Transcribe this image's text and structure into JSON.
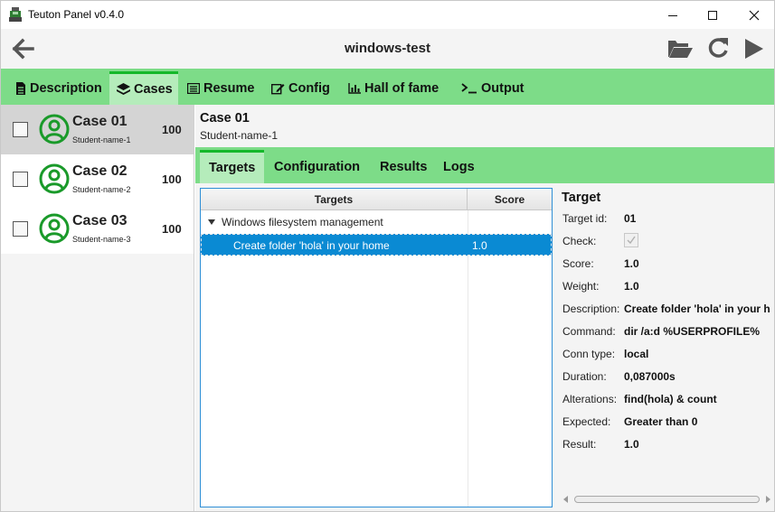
{
  "window": {
    "title": "Teuton Panel v0.4.0"
  },
  "header": {
    "title": "windows-test"
  },
  "main_tabs": [
    {
      "label": "Description",
      "icon": "document-icon"
    },
    {
      "label": "Cases",
      "icon": "layers-icon"
    },
    {
      "label": "Resume",
      "icon": "list-icon"
    },
    {
      "label": "Config",
      "icon": "edit-icon"
    },
    {
      "label": "Hall of fame",
      "icon": "bar-chart-icon"
    },
    {
      "label": "Output",
      "icon": "terminal-icon"
    }
  ],
  "active_main_tab": "Cases",
  "cases": [
    {
      "name": "Case 01",
      "student": "Student-name-1",
      "score": "100"
    },
    {
      "name": "Case 02",
      "student": "Student-name-2",
      "score": "100"
    },
    {
      "name": "Case 03",
      "student": "Student-name-3",
      "score": "100"
    }
  ],
  "selected_case": {
    "title": "Case 01",
    "student": "Student-name-1"
  },
  "sub_tabs": [
    "Targets",
    "Configuration",
    "Results",
    "Logs"
  ],
  "active_sub_tab": "Targets",
  "targets_table": {
    "columns": [
      "Targets",
      "Score"
    ],
    "group": "Windows filesystem management",
    "rows": [
      {
        "target": "Create folder 'hola' in your home",
        "score": "1.0"
      }
    ]
  },
  "details": {
    "title": "Target",
    "rows": [
      {
        "label": "Target id:",
        "value": "01"
      },
      {
        "label": "Check:",
        "value": ""
      },
      {
        "label": "Score:",
        "value": "1.0"
      },
      {
        "label": "Weight:",
        "value": "1.0"
      },
      {
        "label": "Description:",
        "value": "Create folder 'hola' in your h"
      },
      {
        "label": "Command:",
        "value": "dir /a:d %USERPROFILE%"
      },
      {
        "label": "Conn type:",
        "value": "local"
      },
      {
        "label": "Duration:",
        "value": "0,087000s"
      },
      {
        "label": "Alterations:",
        "value": "find(hola) & count"
      },
      {
        "label": "Expected:",
        "value": "Greater than 0"
      },
      {
        "label": "Result:",
        "value": "1.0"
      }
    ]
  },
  "colors": {
    "accent_green": "#7ddc88",
    "active_tab": "#b5ecbb",
    "tab_indicator": "#15b82a",
    "selection_blue": "#0a8ad3",
    "avatar_green": "#1a9a2a"
  }
}
